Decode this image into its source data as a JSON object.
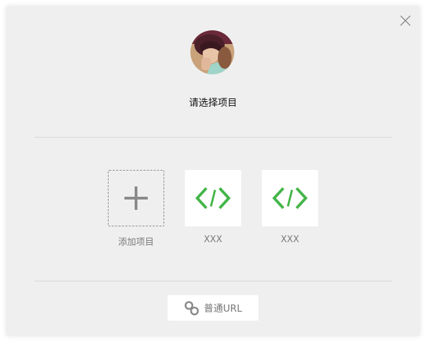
{
  "dialog": {
    "title": "请选择项目",
    "close_icon": "close-icon"
  },
  "avatar": {
    "icon": "user-avatar"
  },
  "projects": [
    {
      "label": "添加项目",
      "icon": "plus-icon"
    },
    {
      "label": "XXX",
      "icon": "code-icon"
    },
    {
      "label": "XXX",
      "icon": "code-icon"
    }
  ],
  "footer": {
    "url_button_label": "普通URL",
    "url_button_icon": "link-icon"
  },
  "colors": {
    "accent_green": "#44b549",
    "background": "#efefef"
  }
}
